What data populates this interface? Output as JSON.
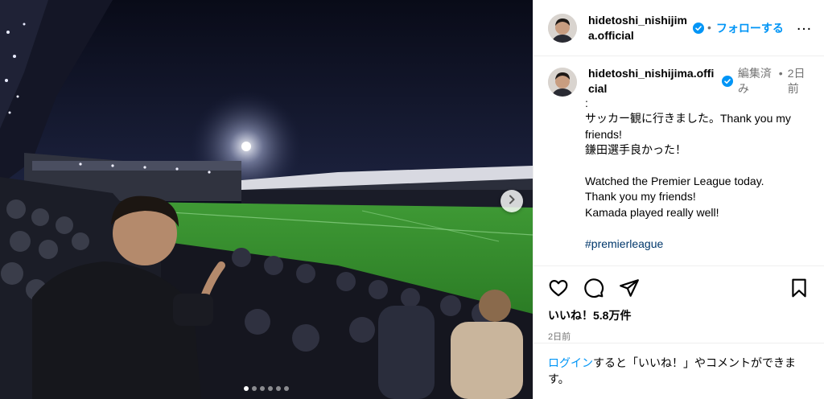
{
  "post": {
    "media": {
      "next_icon": "chevron-right-icon",
      "slide_count": 6,
      "active_slide": 1
    },
    "header": {
      "username": "hidetoshi_nishijima.official",
      "verified_icon": "verified-badge-icon",
      "follow_label": "フォローする",
      "more_label": "…"
    },
    "caption": {
      "username": "hidetoshi_nishijima.official",
      "edited_label": "編集済み",
      "separator": "•",
      "time_ago": "2日前",
      "body": ":\nサッカー観に行きました。Thank you my friends!\n鎌田選手良かった！\n\nWatched the Premier League today.\nThank you my friends!\nKamada played really well!",
      "hashtag": "#premierleague"
    },
    "actions": {
      "like_icon": "heart-icon",
      "comment_icon": "comment-icon",
      "share_icon": "share-icon",
      "save_icon": "bookmark-icon",
      "likes_text": "いいね！5.8万件",
      "date": "2日前"
    },
    "login": {
      "link": "ログイン",
      "rest": "すると「いいね！」やコメントができます。"
    },
    "colors": {
      "accent": "#0095f6",
      "hashtag": "#00376b",
      "muted": "#737373"
    }
  }
}
